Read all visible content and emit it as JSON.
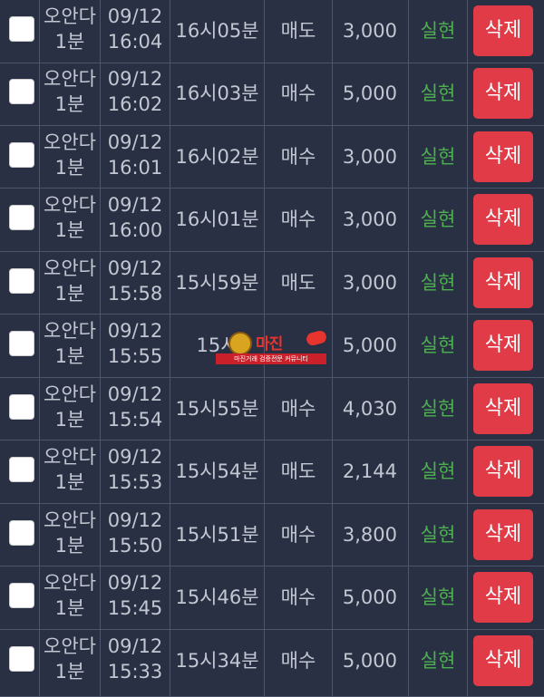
{
  "delete_label": "삭제",
  "colors": {
    "background": "#2a3044",
    "border": "#4d556b",
    "text": "#c3c7d1",
    "type_text": "#4cb04f",
    "delete_button": "#e13b47"
  },
  "watermark": {
    "title": "마진",
    "caption": "마진거래 검증전문 커뮤니티"
  },
  "rows": [
    {
      "name_line1": "오안다",
      "name_line2": "1분",
      "date": "09/12",
      "time": "16:04",
      "minute": "16시05분",
      "side": "매도",
      "qty": "3,000",
      "type": "실현",
      "checked": false
    },
    {
      "name_line1": "오안다",
      "name_line2": "1분",
      "date": "09/12",
      "time": "16:02",
      "minute": "16시03분",
      "side": "매수",
      "qty": "5,000",
      "type": "실현",
      "checked": false
    },
    {
      "name_line1": "오안다",
      "name_line2": "1분",
      "date": "09/12",
      "time": "16:01",
      "minute": "16시02분",
      "side": "매수",
      "qty": "3,000",
      "type": "실현",
      "checked": false
    },
    {
      "name_line1": "오안다",
      "name_line2": "1분",
      "date": "09/12",
      "time": "16:00",
      "minute": "16시01분",
      "side": "매수",
      "qty": "3,000",
      "type": "실현",
      "checked": false
    },
    {
      "name_line1": "오안다",
      "name_line2": "1분",
      "date": "09/12",
      "time": "15:58",
      "minute": "15시59분",
      "side": "매도",
      "qty": "3,000",
      "type": "실현",
      "checked": false
    },
    {
      "name_line1": "오안다",
      "name_line2": "1분",
      "date": "09/12",
      "time": "15:55",
      "minute": "15시",
      "side": "",
      "qty": "5,000",
      "type": "실현",
      "checked": false
    },
    {
      "name_line1": "오안다",
      "name_line2": "1분",
      "date": "09/12",
      "time": "15:54",
      "minute": "15시55분",
      "side": "매수",
      "qty": "4,030",
      "type": "실현",
      "checked": false
    },
    {
      "name_line1": "오안다",
      "name_line2": "1분",
      "date": "09/12",
      "time": "15:53",
      "minute": "15시54분",
      "side": "매도",
      "qty": "2,144",
      "type": "실현",
      "checked": false
    },
    {
      "name_line1": "오안다",
      "name_line2": "1분",
      "date": "09/12",
      "time": "15:50",
      "minute": "15시51분",
      "side": "매수",
      "qty": "3,800",
      "type": "실현",
      "checked": false
    },
    {
      "name_line1": "오안다",
      "name_line2": "1분",
      "date": "09/12",
      "time": "15:45",
      "minute": "15시46분",
      "side": "매수",
      "qty": "5,000",
      "type": "실현",
      "checked": false
    },
    {
      "name_line1": "오안다",
      "name_line2": "1분",
      "date": "09/12",
      "time": "15:33",
      "minute": "15시34분",
      "side": "매수",
      "qty": "5,000",
      "type": "실현",
      "checked": false
    }
  ]
}
